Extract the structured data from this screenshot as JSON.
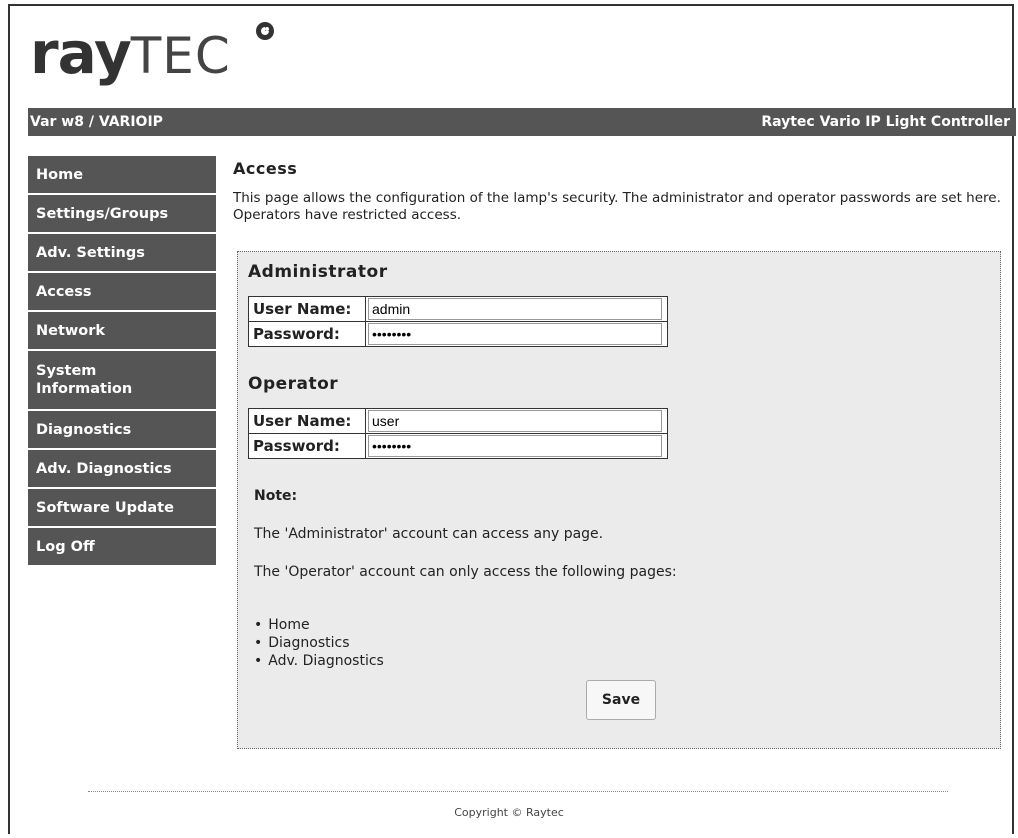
{
  "brand": {
    "logo_ray": "ray",
    "logo_tec": "TEC",
    "logo_icon": "raytec-logo-mark"
  },
  "header": {
    "device": "Var w8 / VARIOIP",
    "product": "Raytec Vario IP Light Controller"
  },
  "sidebar": {
    "items": [
      {
        "label": "Home"
      },
      {
        "label": "Settings/Groups"
      },
      {
        "label": "Adv. Settings"
      },
      {
        "label": "Access"
      },
      {
        "label": "Network"
      },
      {
        "label": "System Information"
      },
      {
        "label": "Diagnostics"
      },
      {
        "label": "Adv. Diagnostics"
      },
      {
        "label": "Software Update"
      },
      {
        "label": "Log Off"
      }
    ]
  },
  "main": {
    "title": "Access",
    "intro": "This page allows the configuration of the lamp's security. The administrator and operator passwords are set here. Operators have restricted access.",
    "administrator": {
      "title": "Administrator",
      "username_label": "User Name:",
      "username_value": "admin",
      "password_label": "Password:",
      "password_value": "password"
    },
    "operator": {
      "title": "Operator",
      "username_label": "User Name:",
      "username_value": "user",
      "password_label": "Password:",
      "password_value": "password"
    },
    "note": {
      "title": "Note:",
      "line1": "The 'Administrator' account can access any page.",
      "line2": "The 'Operator' account can only access the following pages:",
      "pages": [
        "Home",
        "Diagnostics",
        "Adv. Diagnostics"
      ]
    },
    "save_label": "Save"
  },
  "footer": {
    "copyright": "Copyright © Raytec"
  },
  "colors": {
    "nav_bg": "#555555",
    "panel_bg": "#ebebeb",
    "text": "#222222"
  }
}
